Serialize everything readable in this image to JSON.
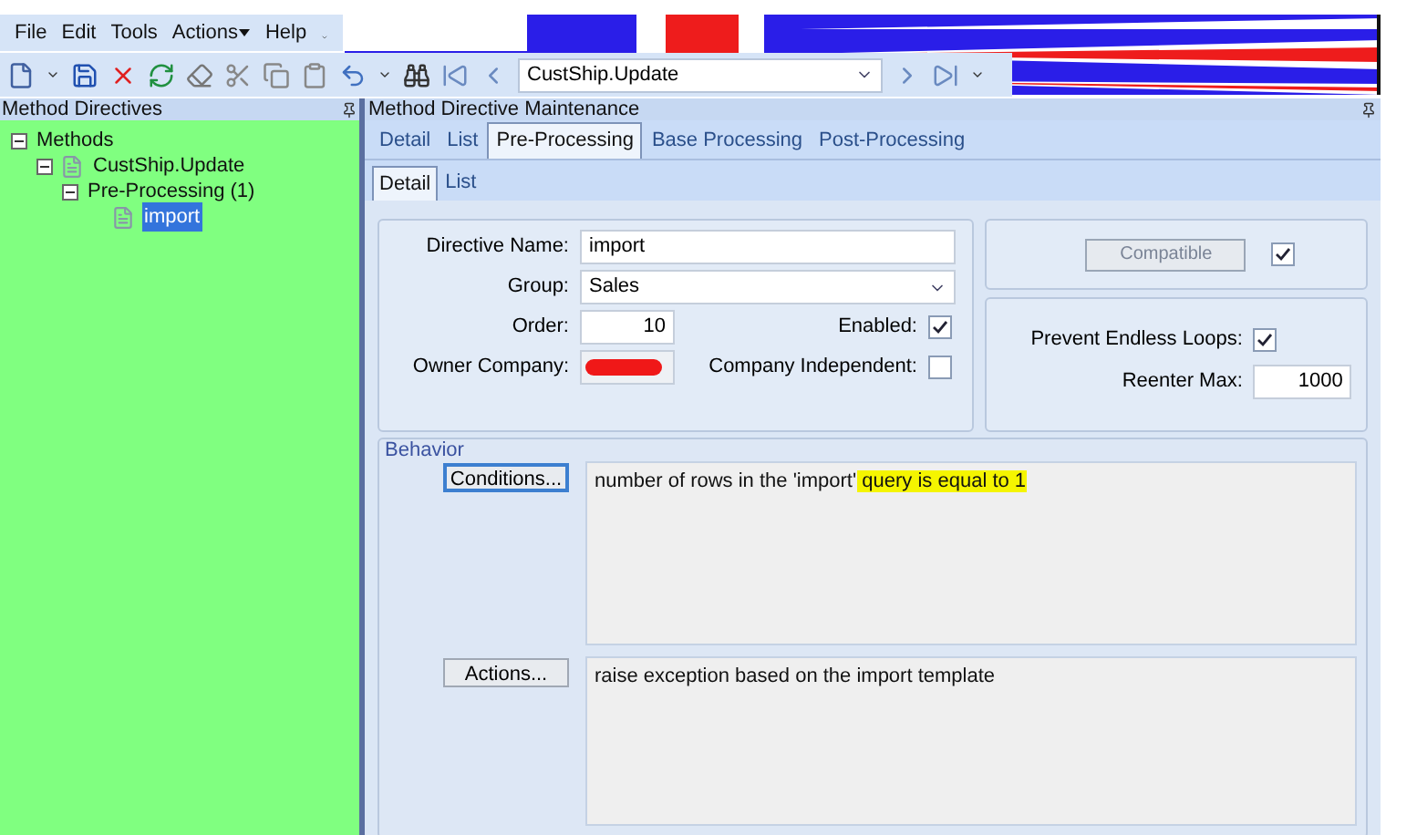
{
  "menu": [
    {
      "label": "File",
      "has_caret": false
    },
    {
      "label": "Edit",
      "has_caret": false
    },
    {
      "label": "Tools",
      "has_caret": false
    },
    {
      "label": "Actions",
      "has_caret": true
    },
    {
      "label": "Help",
      "has_caret": false
    }
  ],
  "toolbar": {
    "method_combo": {
      "value": "CustShip.Update"
    }
  },
  "left_panel": {
    "title": "Method Directives",
    "tree": [
      {
        "label": "Methods",
        "expanded": true,
        "has_icon": false,
        "selected": false,
        "children": [
          {
            "label": "CustShip.Update",
            "expanded": true,
            "has_icon": true,
            "selected": false,
            "children": [
              {
                "label": "Pre-Processing (1)",
                "expanded": true,
                "has_icon": false,
                "selected": false,
                "children": [
                  {
                    "label": "import",
                    "has_icon": true,
                    "selected": true
                  }
                ]
              }
            ]
          }
        ]
      }
    ]
  },
  "right_panel": {
    "title": "Method Directive Maintenance",
    "tabs": [
      {
        "label": "Detail",
        "selected": false
      },
      {
        "label": "List",
        "selected": false
      },
      {
        "label": "Pre-Processing",
        "selected": true
      },
      {
        "label": "Base Processing",
        "selected": false
      },
      {
        "label": "Post-Processing",
        "selected": false
      }
    ],
    "subtabs": [
      {
        "label": "Detail",
        "selected": true
      },
      {
        "label": "List",
        "selected": false
      }
    ],
    "form": {
      "directive_name": {
        "label": "Directive Name:",
        "value": "import"
      },
      "group": {
        "label": "Group:",
        "value": "Sales"
      },
      "order": {
        "label": "Order:",
        "value": "10"
      },
      "owner_company": {
        "label": "Owner Company:",
        "redacted": true
      },
      "enabled": {
        "label": "Enabled:",
        "checked": true
      },
      "company_independent": {
        "label": "Company Independent:",
        "checked": false
      },
      "compatible": {
        "label": "Compatible",
        "checked": true
      },
      "prevent_endless_loops": {
        "label": "Prevent Endless Loops:",
        "checked": true
      },
      "reenter_max": {
        "label": "Reenter Max:",
        "value": "1000"
      }
    },
    "behavior": {
      "title": "Behavior",
      "conditions": {
        "button": "Conditions...",
        "focused": true,
        "parts": [
          {
            "text": "number of rows in the 'import'",
            "highlighted": false
          },
          {
            "text": " query is equal to 1",
            "highlighted": true
          }
        ]
      },
      "actions": {
        "button": "Actions...",
        "focused": false,
        "parts": [
          {
            "text": "raise exception based on the import template",
            "highlighted": false
          }
        ]
      }
    }
  }
}
